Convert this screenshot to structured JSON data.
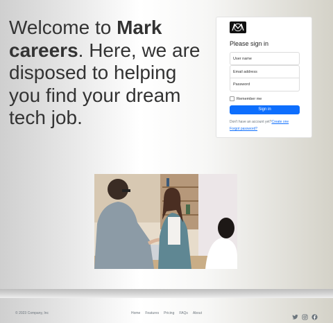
{
  "hero": {
    "line_prefix": "Welcome to ",
    "brand": "Mark careers",
    "line_rest": ". Here, we are disposed to helping you find your dream tech job."
  },
  "signin": {
    "title": "Please sign in",
    "username_placeholder": "User name",
    "email_placeholder": "Email address",
    "password_placeholder": "Password",
    "remember_label": "Remember me",
    "button_label": "Sign in",
    "no_account_text": "Don't have an account yet?",
    "create_link": "Create one",
    "forgot_link": "Forgot password?"
  },
  "footer": {
    "copyright": "© 2023 Company, Inc",
    "links": [
      "Home",
      "Features",
      "Pricing",
      "FAQs",
      "About"
    ],
    "social_icons": [
      "twitter-icon",
      "instagram-icon",
      "facebook-icon"
    ]
  },
  "colors": {
    "primary": "#0d6efd",
    "text_muted": "#6c757d"
  }
}
